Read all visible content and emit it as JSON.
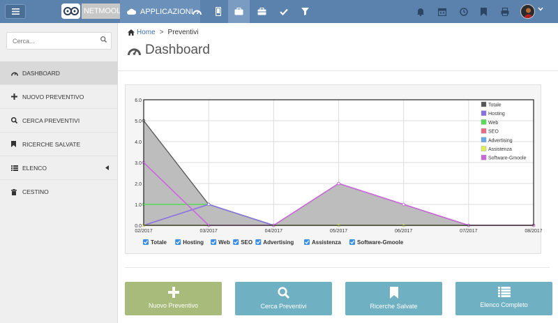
{
  "header": {
    "brand": "NETMOOLE",
    "app_menu_label": "APPLICAZIONI"
  },
  "sidebar": {
    "search_placeholder": "Cerca...",
    "items": [
      {
        "label": "DASHBOARD",
        "icon": "dashboard-icon",
        "active": true
      },
      {
        "label": "NUOVO PREVENTIVO",
        "icon": "plus-icon"
      },
      {
        "label": "CERCA PREVENTIVI",
        "icon": "search-icon"
      },
      {
        "label": "RICERCHE SALVATE",
        "icon": "bookmark-icon"
      },
      {
        "label": "ELENCO",
        "icon": "list-icon"
      },
      {
        "label": "CESTINO",
        "icon": "trash-icon"
      }
    ]
  },
  "breadcrumb": {
    "home": "Home",
    "current": "Preventivi"
  },
  "page": {
    "title": "Dashboard"
  },
  "chart_data": {
    "type": "area",
    "categories": [
      "02/2017",
      "03/2017",
      "04/2017",
      "05/2017",
      "06/2017",
      "07/2017",
      "08/2017"
    ],
    "ylim": [
      0,
      6
    ],
    "yticks": [
      "0.0",
      "1.0",
      "2.0",
      "3.0",
      "4.0",
      "5.0",
      "6.0"
    ],
    "grid": true,
    "legend_position": "top-right",
    "series": [
      {
        "name": "Totale",
        "color": "#555555",
        "values": [
          5,
          1,
          0,
          2,
          1,
          0,
          0
        ]
      },
      {
        "name": "Hosting",
        "color": "#8b6fe0",
        "values": [
          0,
          1,
          0,
          0,
          0,
          0,
          0
        ]
      },
      {
        "name": "Web",
        "color": "#55dd55",
        "values": [
          1,
          1,
          0,
          0,
          0,
          0,
          0
        ]
      },
      {
        "name": "SEO",
        "color": "#ee6688",
        "values": [
          0,
          0,
          0,
          0,
          0,
          0,
          0
        ]
      },
      {
        "name": "Advertising",
        "color": "#66aaee",
        "values": [
          0,
          0,
          0,
          0,
          0,
          0,
          0
        ]
      },
      {
        "name": "Assistenza",
        "color": "#ddee55",
        "values": [
          0,
          0,
          0,
          0,
          0,
          0,
          0
        ]
      },
      {
        "name": "Software-Gmoole",
        "color": "#cc66dd",
        "values": [
          3,
          0,
          0,
          2,
          1,
          0,
          0
        ]
      }
    ],
    "toggles": [
      "Totale",
      "Hosting",
      "Web",
      "SEO",
      "Advertising",
      "Assistenza",
      "Software-Gmoole"
    ]
  },
  "actions": [
    {
      "label": "Nuovo Preventivo",
      "icon": "plus-icon",
      "color": "#a8bb7a"
    },
    {
      "label": "Cerca Preventivi",
      "icon": "search-icon",
      "color": "#6fb0c3"
    },
    {
      "label": "Ricerche Salvate",
      "icon": "bookmark-icon",
      "color": "#6fb0c3"
    },
    {
      "label": "Elenco Completo",
      "icon": "list-icon",
      "color": "#6fb0c3"
    }
  ]
}
